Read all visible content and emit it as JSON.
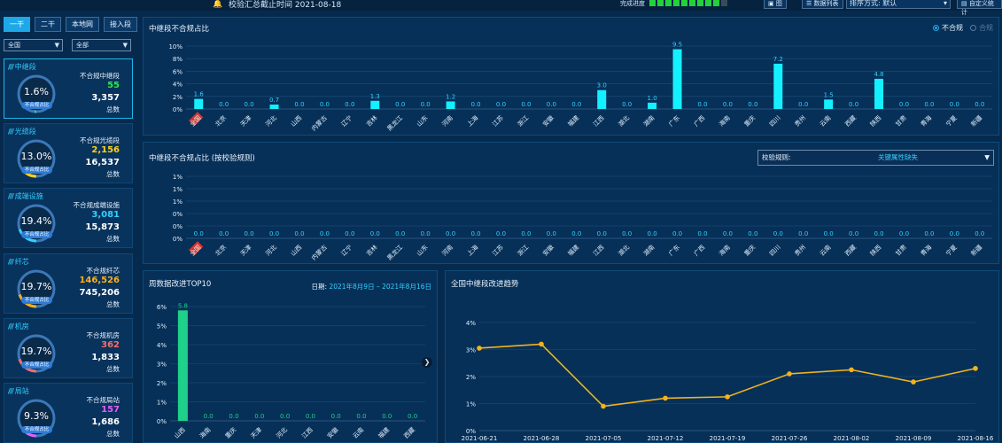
{
  "topbar": {
    "deadline": "校验汇总截止时间 2021-08-18",
    "progress_label": "完成进度",
    "progress_segments": 10,
    "progress_filled": 9,
    "btn_export_image": "图",
    "btn_data_list": "数据列表",
    "sort_label": "排序方式: 默认",
    "btn_last": "自定义统计"
  },
  "sidebar": {
    "tabs": [
      {
        "label": "一干",
        "active": true
      },
      {
        "label": "二干",
        "active": false
      },
      {
        "label": "本地网",
        "active": false
      },
      {
        "label": "接入段",
        "active": false
      }
    ],
    "select_region": "全国",
    "select_scope": "全部",
    "cards": [
      {
        "name": "中继段",
        "pct": "1.6%",
        "badge": "不合规占比",
        "noncompliant_label": "不合规中继段",
        "noncompliant": "55",
        "total": "3,357",
        "total_label": "总数",
        "color": "#2ee64f",
        "ratio": 0.016
      },
      {
        "name": "光缆段",
        "pct": "13.0%",
        "badge": "不合规占比",
        "noncompliant_label": "不合规光缆段",
        "noncompliant": "2,156",
        "total": "16,537",
        "total_label": "总数",
        "color": "#ffd21a",
        "ratio": 0.13
      },
      {
        "name": "成端设施",
        "pct": "19.4%",
        "badge": "不合规占比",
        "noncompliant_label": "不合规成端设施",
        "noncompliant": "3,081",
        "total": "15,873",
        "total_label": "总数",
        "color": "#33d0ff",
        "ratio": 0.194
      },
      {
        "name": "纤芯",
        "pct": "19.7%",
        "badge": "不合规占比",
        "noncompliant_label": "不合规纤芯",
        "noncompliant": "146,526",
        "total": "745,206",
        "total_label": "总数",
        "color": "#ffae1a",
        "ratio": 0.197
      },
      {
        "name": "机房",
        "pct": "19.7%",
        "badge": "不合规占比",
        "noncompliant_label": "不合规机房",
        "noncompliant": "362",
        "total": "1,833",
        "total_label": "总数",
        "color": "#ff6b6b",
        "ratio": 0.197
      },
      {
        "name": "局站",
        "pct": "9.3%",
        "badge": "不合规占比",
        "noncompliant_label": "不合规局站",
        "noncompliant": "157",
        "total": "1,686",
        "total_label": "总数",
        "color": "#e85cff",
        "ratio": 0.093
      }
    ]
  },
  "panel_top": {
    "title": "中继段不合规占比",
    "legend_on": "不合规",
    "legend_off": "合规"
  },
  "panel_mid": {
    "title": "中继段不合规占比 (按校验规则)",
    "rule_label": "校验规则:",
    "rule_value": "关键属性缺失"
  },
  "panel_week": {
    "title": "周数据改进TOP10",
    "date_label": "日期:",
    "date_value": "2021年8月9日 – 2021年8月16日"
  },
  "panel_trend": {
    "title": "全国中继段改进趋势"
  },
  "chart_data": [
    {
      "type": "bar",
      "title": "中继段不合规占比",
      "categories": [
        "全国",
        "北京",
        "天津",
        "河北",
        "山西",
        "内蒙古",
        "辽宁",
        "吉林",
        "黑龙江",
        "山东",
        "河南",
        "上海",
        "江苏",
        "浙江",
        "安徽",
        "福建",
        "江西",
        "湖北",
        "湖南",
        "广东",
        "广西",
        "海南",
        "重庆",
        "四川",
        "贵州",
        "云南",
        "西藏",
        "陕西",
        "甘肃",
        "青海",
        "宁夏",
        "新疆"
      ],
      "values": [
        1.6,
        0.0,
        0.0,
        0.7,
        0.0,
        0.0,
        0.0,
        1.3,
        0.0,
        0.0,
        1.2,
        0.0,
        0.0,
        0.0,
        0.0,
        0.0,
        3.0,
        0.0,
        1.0,
        9.5,
        0.0,
        0.0,
        0.0,
        7.2,
        0.0,
        1.5,
        0.0,
        4.8,
        0.0,
        0.0,
        0.0,
        0.0
      ],
      "yticks": [
        "0%",
        "2%",
        "4%",
        "6%",
        "8%",
        "10%"
      ],
      "ylim": [
        0,
        10
      ]
    },
    {
      "type": "bar",
      "title": "中继段不合规占比 (按校验规则)",
      "categories": [
        "全国",
        "北京",
        "天津",
        "河北",
        "山西",
        "内蒙古",
        "辽宁",
        "吉林",
        "黑龙江",
        "山东",
        "河南",
        "上海",
        "江苏",
        "浙江",
        "安徽",
        "福建",
        "江西",
        "湖北",
        "湖南",
        "广东",
        "广西",
        "海南",
        "重庆",
        "四川",
        "贵州",
        "云南",
        "西藏",
        "陕西",
        "甘肃",
        "青海",
        "宁夏",
        "新疆"
      ],
      "values": [
        0.0,
        0.0,
        0.0,
        0.0,
        0.0,
        0.0,
        0.0,
        0.0,
        0.0,
        0.0,
        0.0,
        0.0,
        0.0,
        0.0,
        0.0,
        0.0,
        0.0,
        0.0,
        0.0,
        0.0,
        0.0,
        0.0,
        0.0,
        0.0,
        0.0,
        0.0,
        0.0,
        0.0,
        0.0,
        0.0,
        0.0,
        0.0
      ],
      "yticks": [
        "0%",
        "0%",
        "0%",
        "1%",
        "1%",
        "1%"
      ],
      "ylim": [
        0,
        1
      ]
    },
    {
      "type": "bar",
      "title": "周数据改进TOP10",
      "categories": [
        "山西",
        "海南",
        "重庆",
        "天津",
        "河北",
        "江西",
        "安徽",
        "云南",
        "福建",
        "西藏"
      ],
      "values": [
        5.8,
        0.0,
        0.0,
        0.0,
        0.0,
        0.0,
        0.0,
        0.0,
        0.0,
        0.0
      ],
      "yticks": [
        "0%",
        "1%",
        "2%",
        "3%",
        "4%",
        "5%",
        "6%"
      ],
      "ylim": [
        0,
        6
      ]
    },
    {
      "type": "line",
      "title": "全国中继段改进趋势",
      "x": [
        "2021-06-21",
        "2021-06-28",
        "2021-07-05",
        "2021-07-12",
        "2021-07-19",
        "2021-07-26",
        "2021-08-02",
        "2021-08-09",
        "2021-08-16"
      ],
      "values": [
        3.05,
        3.2,
        0.9,
        1.2,
        1.25,
        2.1,
        2.25,
        1.8,
        2.3
      ],
      "yticks": [
        "0%",
        "1%",
        "2%",
        "3%",
        "4%"
      ],
      "ylim": [
        0,
        4
      ]
    }
  ]
}
